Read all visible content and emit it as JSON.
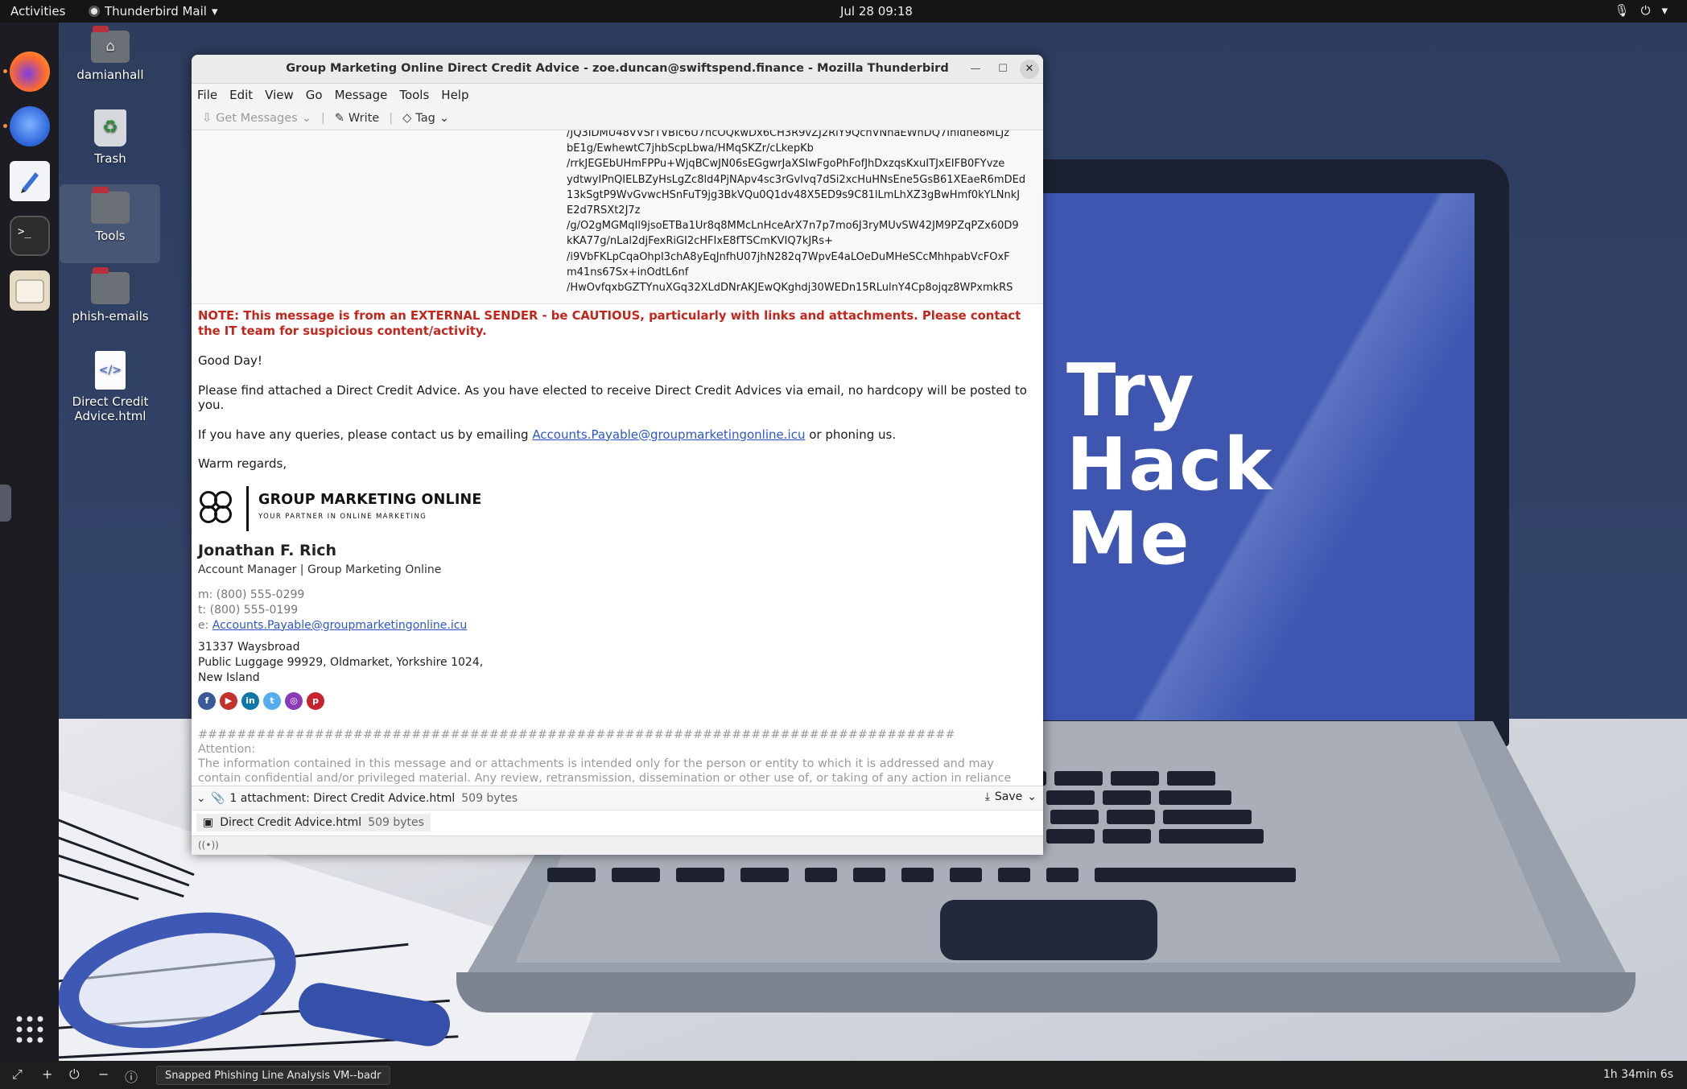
{
  "topbar": {
    "activities": "Activities",
    "app_name": "Thunderbird Mail",
    "clock": "Jul 28  09:18"
  },
  "desktop": {
    "icons": [
      {
        "label": "damianhall"
      },
      {
        "label": "Trash"
      },
      {
        "label": "Tools"
      },
      {
        "label": "phish-emails"
      },
      {
        "label": "Direct Credit Advice.html"
      }
    ],
    "wallpaper_text": [
      "Try",
      "Hack",
      "Me"
    ]
  },
  "window": {
    "title": "Group Marketing Online Direct Credit Advice - zoe.duncan@swiftspend.finance - Mozilla Thunderbird",
    "menu": [
      "File",
      "Edit",
      "View",
      "Go",
      "Message",
      "Tools",
      "Help"
    ],
    "toolbar": {
      "get_messages": "Get Messages",
      "write": "Write",
      "tag": "Tag"
    },
    "raw_lines": [
      "/JQ3IDMU48VVSrTVBIc6U7ncOQkwDx6CH3R9vZJ2RlY9QchVNhaEWnDQ7InIdne8MLJz",
      "bE1g/EwhewtC7jhbScpLbwa/HMqSKZr/cLkepKb",
      "/rrkJEGEbUHmFPPu+WjqBCwJN06sEGgwrJaXSIwFgoPhFofJhDxzqsKxuITJxEIFB0FYvze",
      "ydtwyIPnQIELBZyHsLgZc8ld4PjNApv4sc3rGvIvq7dSi2xcHuHNsEne5GsB61XEaeR6mDEd",
      "13kSgtP9WvGvwcHSnFuT9jg3BkVQu0Q1dv48X5ED9s9C81lLmLhXZ3gBwHmf0kYLNnkJ",
      "E2d7RSXt2J7z",
      "/g/O2gMGMqIl9jsoETBa1Ur8q8MMcLnHceArX7n7p7mo6J3ryMUvSW42JM9PZqPZx60D9",
      "kKA77g/nLal2djFexRiGI2cHFIxE8fTSCmKVIQ7kJRs+",
      "/i9VbFKLpCqaOhpI3chA8yEqJnfhU07jhN282q7WpvE4aLOeDuMHeSCcMhhpabVcFOxF",
      "m41ns67Sx+inOdtL6nf",
      "/HwOvfqxbGZTYnuXGq32XLdDNrAKJEwQKghdj30WEDn15RLulnY4Cp8ojqz8WPxmkRS"
    ],
    "message": {
      "note": "NOTE: This message is from an EXTERNAL SENDER - be CAUTIOUS, particularly with links and attachments. Please contact the IT team for suspicious content/activity.",
      "greeting": "Good Day!",
      "para1": "Please find attached a Direct Credit Advice. As you have elected to receive Direct Credit Advices via email, no hardcopy will be posted to you.",
      "para2_before": "If you have any queries, please contact us by emailing ",
      "para2_link": "Accounts.Payable@groupmarketingonline.icu",
      "para2_after": " or phoning us.",
      "closing": "Warm regards,",
      "logo_name": "GROUP MARKETING ONLINE",
      "logo_tagline": "YOUR PARTNER IN ONLINE MARKETING",
      "sig_name": "Jonathan F. Rich",
      "sig_role": "Account Manager | Group Marketing Online",
      "sig_mobile": "m: (800) 555-0299",
      "sig_phone": "t: (800) 555-0199",
      "sig_email_prefix": "e: ",
      "sig_email": "Accounts.Payable@groupmarketingonline.icu",
      "addr1": "31337 Waysbroad",
      "addr2": "Public Luggage 99929, Oldmarket, Yorkshire 1024,",
      "addr3": "New Island",
      "social": [
        "facebook-icon",
        "youtube-icon",
        "linkedin-icon",
        "twitter-icon",
        "instagram-icon",
        "pinterest-icon"
      ],
      "hashes": "##############################################################################",
      "attention": "Attention:",
      "disclaimer": "The information contained in this message and or attachments is intended only for the person or entity to which it is addressed and may contain confidential and/or privileged material. Any review, retransmission, dissemination or other use of, or taking of any action in reliance"
    },
    "attachments": {
      "summary": "1 attachment: Direct Credit Advice.html",
      "summary_size": "509 bytes",
      "save": "Save",
      "file_name": "Direct Credit Advice.html",
      "file_size": "509 bytes"
    }
  },
  "bottombar": {
    "task": "Snapped Phishing Line Analysis VM--badr",
    "timer": "1h 34min 6s"
  },
  "colors": {
    "warning": "#c4261c",
    "link": "#2b57c9",
    "screen": "#3e56b0"
  }
}
